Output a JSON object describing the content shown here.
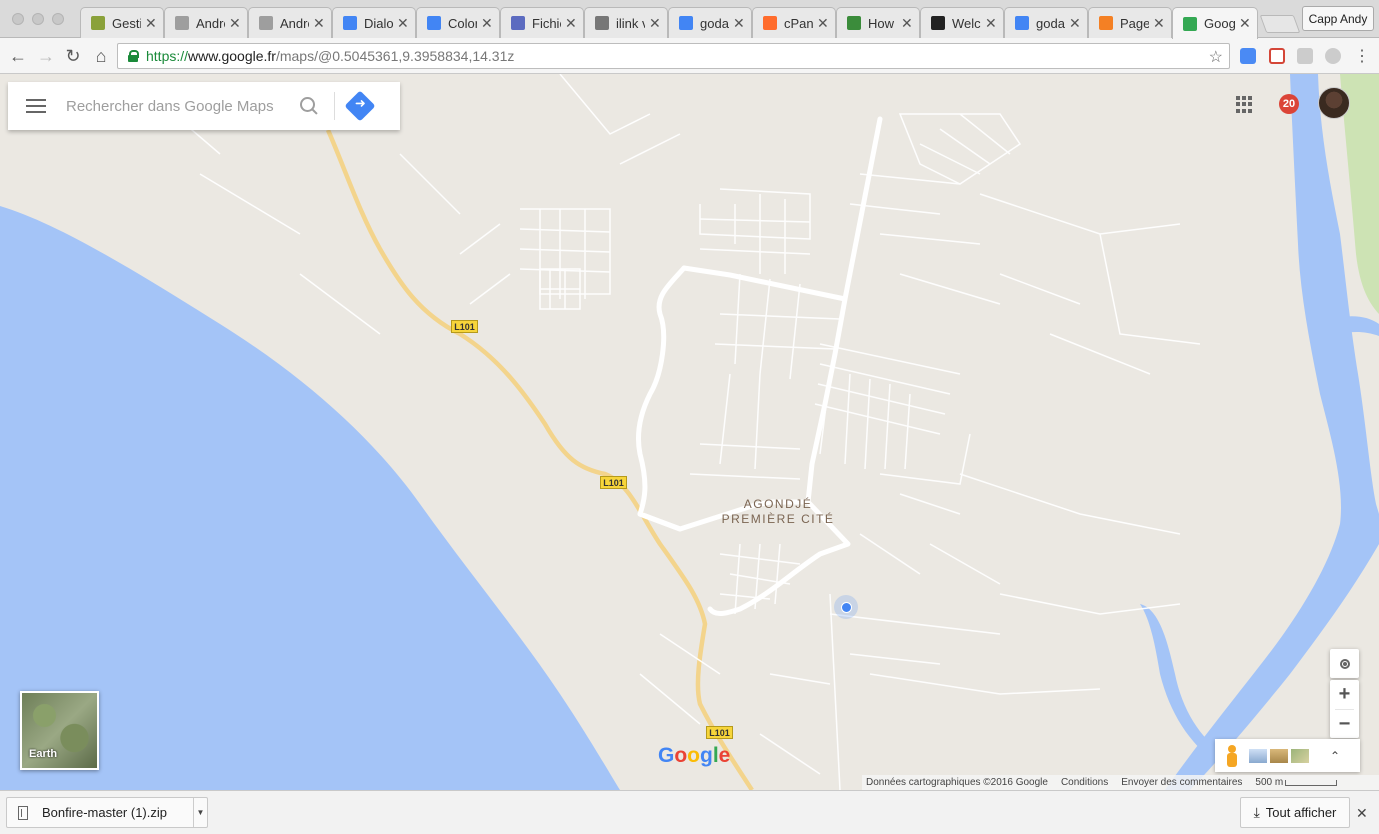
{
  "browser": {
    "tabs": [
      {
        "title": "Gestion d",
        "favicon_color": "#8aa13a"
      },
      {
        "title": "Android",
        "favicon_color": "#9e9e9e"
      },
      {
        "title": "Android",
        "favicon_color": "#9e9e9e"
      },
      {
        "title": "Dialogs",
        "favicon_color": "#4285f4"
      },
      {
        "title": "Colors",
        "favicon_color": "#4285f4"
      },
      {
        "title": "Fichier",
        "favicon_color": "#5c6bc0"
      },
      {
        "title": "ilink v",
        "favicon_color": "#777777"
      },
      {
        "title": "godaddy",
        "favicon_color": "#4285f4"
      },
      {
        "title": "cPanel",
        "favicon_color": "#ff6c2c"
      },
      {
        "title": "How t",
        "favicon_color": "#3b8c3b"
      },
      {
        "title": "Welcom",
        "favicon_color": "#222222"
      },
      {
        "title": "godaddy",
        "favicon_color": "#4285f4"
      },
      {
        "title": "Page",
        "favicon_color": "#f48024"
      },
      {
        "title": "Google",
        "favicon_color": "#34a853"
      }
    ],
    "profile_name": "Capp Andy",
    "url": {
      "scheme": "https://",
      "host": "www.google.fr",
      "path": "/maps/@0.5045361,9.3958834,14.31z"
    }
  },
  "maps": {
    "search_placeholder": "Rechercher dans Google Maps",
    "notification_count": "20",
    "place_label_line1": "AGONDJÉ",
    "place_label_line2": "PREMIÈRE CITÉ",
    "road_label": "L101",
    "earth_label": "Earth",
    "logo_letters": [
      "G",
      "o",
      "o",
      "g",
      "l",
      "e"
    ],
    "logo_colors": [
      "#4285f4",
      "#ea4335",
      "#fbbc05",
      "#4285f4",
      "#34a853",
      "#ea4335"
    ],
    "footer": {
      "data_credit": "Données cartographiques ©2016 Google",
      "terms": "Conditions",
      "feedback": "Envoyer des commentaires",
      "scale": "500 m"
    },
    "colors": {
      "land": "#ebe8e2",
      "water": "#a4c4f7",
      "road": "#ffffff",
      "highway": "#f7d98a"
    }
  },
  "downloads": {
    "file_name": "Bonfire-master (1).zip",
    "show_all": "Tout afficher"
  }
}
